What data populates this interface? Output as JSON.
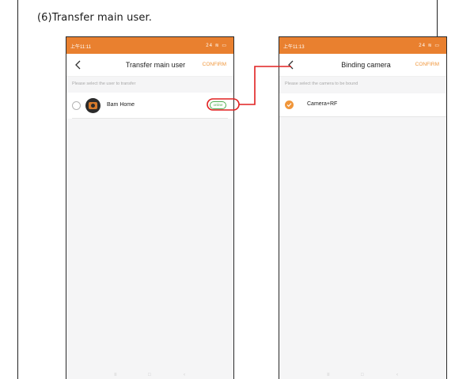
{
  "caption": "(6)Transfer main user.",
  "colors": {
    "accent": "#f0963a",
    "online_green": "#4caf50",
    "connector_red": "#e02020"
  },
  "left_screen": {
    "status_time": "上午11:11",
    "status_icons": "24 ≋ ▭",
    "back_icon": "chevron-left-icon",
    "title": "Transfer main user",
    "confirm": "CONFIRM",
    "hint": "Please select the user to transfer",
    "user": {
      "name": "Bam Home",
      "status": "online",
      "selected": false
    }
  },
  "right_screen": {
    "status_time": "上午11:13",
    "status_icons": "24 ≋ ▭",
    "back_icon": "chevron-left-icon",
    "title": "Binding camera",
    "confirm": "CONFIRM",
    "hint": "Please select the camera to be bound",
    "camera": {
      "name": "Camera+RF",
      "selected": true
    }
  },
  "system_nav": {
    "menu": "≡",
    "home": "□",
    "back": "‹"
  }
}
